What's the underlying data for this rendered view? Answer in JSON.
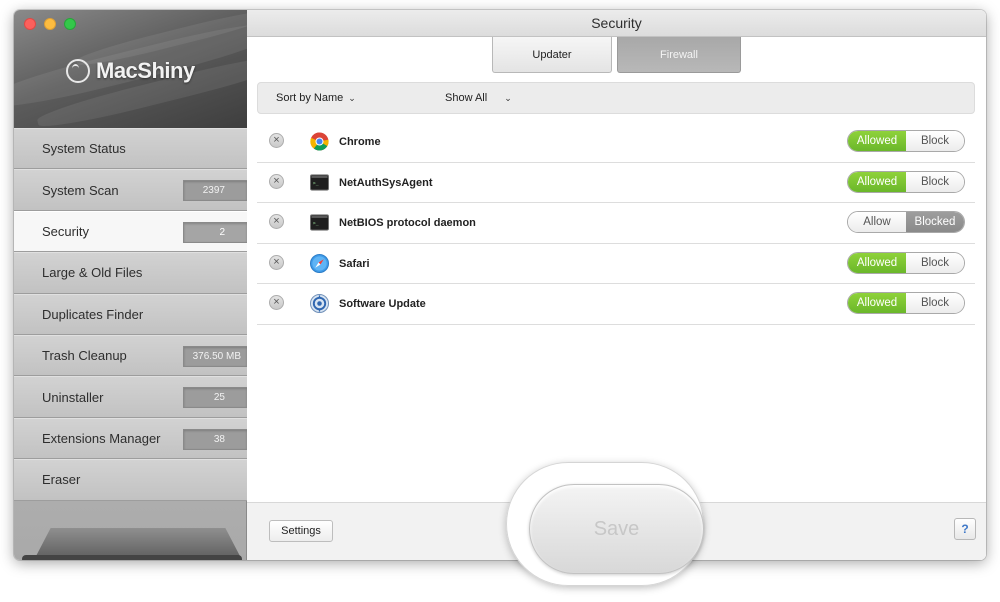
{
  "window": {
    "title": "Security"
  },
  "brand": {
    "name": "MacShiny"
  },
  "sidebar": {
    "items": [
      {
        "label": "System Status",
        "badge": ""
      },
      {
        "label": "System Scan",
        "badge": "2397"
      },
      {
        "label": "Security",
        "badge": "2",
        "active": true
      },
      {
        "label": "Large & Old Files",
        "badge": ""
      },
      {
        "label": "Duplicates Finder",
        "badge": ""
      },
      {
        "label": "Trash Cleanup",
        "badge": "376.50 MB"
      },
      {
        "label": "Uninstaller",
        "badge": "25"
      },
      {
        "label": "Extensions Manager",
        "badge": "38"
      },
      {
        "label": "Eraser",
        "badge": ""
      }
    ]
  },
  "tabs": [
    {
      "label": "Updater",
      "active": false
    },
    {
      "label": "Firewall",
      "active": true
    }
  ],
  "filters": {
    "sort_label": "Sort by Name",
    "show_label": "Show All"
  },
  "apps": [
    {
      "name": "Chrome",
      "icon": "chrome-icon",
      "left": "Allowed",
      "right": "Block",
      "state": "allowed"
    },
    {
      "name": "NetAuthSysAgent",
      "icon": "terminal-icon",
      "left": "Allowed",
      "right": "Block",
      "state": "allowed"
    },
    {
      "name": "NetBIOS protocol daemon",
      "icon": "terminal-icon",
      "left": "Allow",
      "right": "Blocked",
      "state": "blocked"
    },
    {
      "name": "Safari",
      "icon": "safari-icon",
      "left": "Allowed",
      "right": "Block",
      "state": "allowed"
    },
    {
      "name": "Software Update",
      "icon": "software-update-icon",
      "left": "Allowed",
      "right": "Block",
      "state": "allowed"
    }
  ],
  "footer": {
    "settings_label": "Settings",
    "save_label": "Save",
    "help_label": "?"
  },
  "colors": {
    "allowed_green": "#7cc832",
    "blocked_gray": "#949494",
    "traffic_red": "#fc605c",
    "traffic_yellow": "#fdbc40",
    "traffic_green": "#34c84a"
  }
}
